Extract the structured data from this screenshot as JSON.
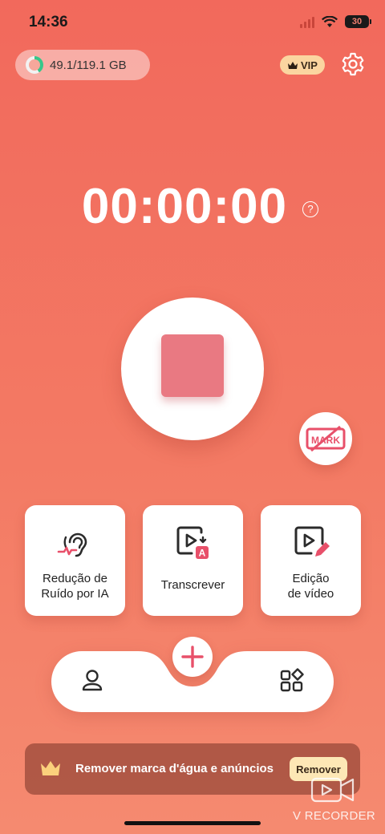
{
  "status_bar": {
    "time": "14:36",
    "battery": "30"
  },
  "storage": {
    "text": "49.1/119.1 GB",
    "used_fraction": 0.41
  },
  "vip": {
    "label": "VIP"
  },
  "timer": {
    "value": "00:00:00",
    "help_glyph": "?"
  },
  "mark": {
    "label": "MARK"
  },
  "features": [
    {
      "label_line1": "Redução de",
      "label_line2": "Ruído por IA",
      "icon": "ear-noise-icon"
    },
    {
      "label_line1": "Transcrever",
      "label_line2": "",
      "icon": "transcribe-icon"
    },
    {
      "label_line1": "Edição",
      "label_line2": "de vídeo",
      "icon": "video-edit-icon"
    }
  ],
  "nav": {
    "add_glyph": "+"
  },
  "promo": {
    "text": "Remover marca d'água e anúncios",
    "button": "Remover"
  },
  "watermark": {
    "text": "V RECORDER"
  },
  "colors": {
    "accent": "#e8506a",
    "stop_button": "#e97982",
    "background_top": "#f2695c",
    "background_bottom": "#f58a70"
  }
}
